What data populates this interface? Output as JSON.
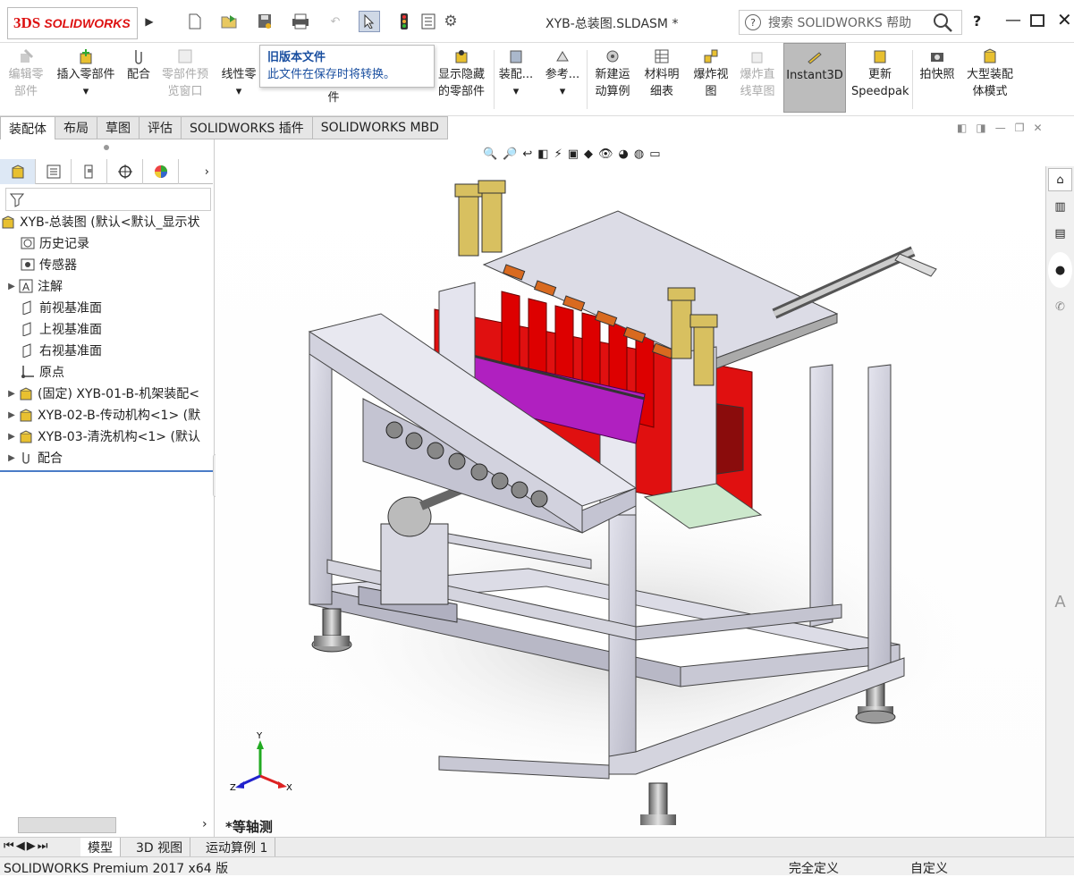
{
  "app": {
    "logo_text": "SOLIDWORKS",
    "logo_mark": "3DS"
  },
  "title_bar": {
    "document_title": "XYB-总装图.SLDASM *",
    "help_search_placeholder": "搜索 SOLIDWORKS 帮助",
    "help_menu": "?",
    "icons": [
      "new-document-icon",
      "open-icon",
      "save-icon",
      "print-icon",
      "undo-icon",
      "select-icon",
      "rebuild-icon",
      "file-properties-icon",
      "options-gear-icon"
    ]
  },
  "command_manager": {
    "items": [
      {
        "label": "编辑零部件",
        "line1": "编辑零",
        "line2": "部件",
        "enabled": false,
        "icon": "edit-component-icon"
      },
      {
        "label": "插入零部件",
        "line1": "插入零部件",
        "line2": "▾",
        "enabled": true,
        "icon": "insert-component-icon"
      },
      {
        "label": "配合",
        "line1": "配合",
        "line2": "",
        "enabled": true,
        "icon": "mate-icon"
      },
      {
        "label": "零部件预览窗口",
        "line1": "零部件预",
        "line2": "览窗口",
        "enabled": false,
        "icon": "component-preview-icon"
      },
      {
        "label": "线性零部件阵列",
        "line1": "线性零",
        "line2": "▾",
        "enabled": true,
        "icon": "linear-pattern-icon"
      },
      {
        "label": "显示隐藏的零部件",
        "line1": "显示隐藏",
        "line2": "的零部件",
        "enabled": true,
        "icon": "show-hidden-icon"
      },
      {
        "label": "装配体特征",
        "line1": "装配...",
        "line2": "▾",
        "enabled": true,
        "icon": "assembly-feature-icon"
      },
      {
        "label": "参考几何体",
        "line1": "参考...",
        "line2": "▾",
        "enabled": true,
        "icon": "reference-geometry-icon"
      },
      {
        "label": "新建运动算例",
        "line1": "新建运",
        "line2": "动算例",
        "enabled": true,
        "icon": "motion-study-icon"
      },
      {
        "label": "材料明细表",
        "line1": "材料明",
        "line2": "细表",
        "enabled": true,
        "icon": "bom-icon"
      },
      {
        "label": "爆炸视图",
        "line1": "爆炸视",
        "line2": "图",
        "enabled": true,
        "icon": "exploded-view-icon"
      },
      {
        "label": "爆炸直线草图",
        "line1": "爆炸直",
        "line2": "线草图",
        "enabled": false,
        "icon": "explode-line-icon"
      },
      {
        "label": "Instant3D",
        "line1": "Instant3D",
        "line2": "",
        "enabled": true,
        "icon": "instant3d-icon"
      },
      {
        "label": "更新Speedpak",
        "line1": "更新",
        "line2": "Speedpak",
        "enabled": true,
        "icon": "speedpak-icon"
      },
      {
        "label": "拍快照",
        "line1": "拍快照",
        "line2": "",
        "enabled": true,
        "icon": "snapshot-icon"
      },
      {
        "label": "大型装配体模式",
        "line1": "大型装配",
        "line2": "体模式",
        "enabled": true,
        "icon": "large-assembly-icon"
      }
    ],
    "extra_line": "件"
  },
  "tooltip": {
    "title": "旧版本文件",
    "body": "此文件在保存时将转换。"
  },
  "tabs": [
    {
      "label": "装配体",
      "active": true
    },
    {
      "label": "布局",
      "active": false
    },
    {
      "label": "草图",
      "active": false
    },
    {
      "label": "评估",
      "active": false
    },
    {
      "label": "SOLIDWORKS 插件",
      "active": false
    },
    {
      "label": "SOLIDWORKS MBD",
      "active": false
    }
  ],
  "feature_tree": {
    "panel_tabs": [
      "feature-manager-icon",
      "property-manager-icon",
      "configuration-manager-icon",
      "dimxpert-icon",
      "display-manager-icon"
    ],
    "items": [
      {
        "label": "XYB-总装图 (默认<默认_显示状",
        "icon": "assembly-icon",
        "expand": ""
      },
      {
        "label": "历史记录",
        "icon": "history-icon",
        "expand": ""
      },
      {
        "label": "传感器",
        "icon": "sensor-icon",
        "expand": ""
      },
      {
        "label": "注解",
        "icon": "annotation-icon",
        "expand": "▶"
      },
      {
        "label": "前视基准面",
        "icon": "plane-icon",
        "expand": ""
      },
      {
        "label": "上视基准面",
        "icon": "plane-icon",
        "expand": ""
      },
      {
        "label": "右视基准面",
        "icon": "plane-icon",
        "expand": ""
      },
      {
        "label": "原点",
        "icon": "origin-icon",
        "expand": ""
      },
      {
        "label": "(固定) XYB-01-B-机架装配<",
        "icon": "subassembly-icon",
        "expand": "▶"
      },
      {
        "label": "XYB-02-B-传动机构<1> (默",
        "icon": "subassembly-icon",
        "expand": "▶"
      },
      {
        "label": "XYB-03-清洗机构<1> (默认",
        "icon": "subassembly-icon",
        "expand": "▶"
      },
      {
        "label": "配合",
        "icon": "mates-icon",
        "expand": "▶"
      }
    ]
  },
  "viewport": {
    "view_label": "*等轴测",
    "triad": {
      "x": "X",
      "y": "Y",
      "z": "Z"
    }
  },
  "bottom_tabs": [
    {
      "label": "模型",
      "active": true
    },
    {
      "label": "3D 视图",
      "active": false
    },
    {
      "label": "运动算例 1",
      "active": false
    }
  ],
  "status_bar": {
    "product": "SOLIDWORKS Premium 2017 x64 版",
    "state": "完全定义",
    "units": "自定义"
  },
  "colors": {
    "frame": "#c8c8d4",
    "red_part": "#e01010",
    "magenta_part": "#b020c0",
    "brass": "#d8c060",
    "copper": "#d86a20"
  }
}
